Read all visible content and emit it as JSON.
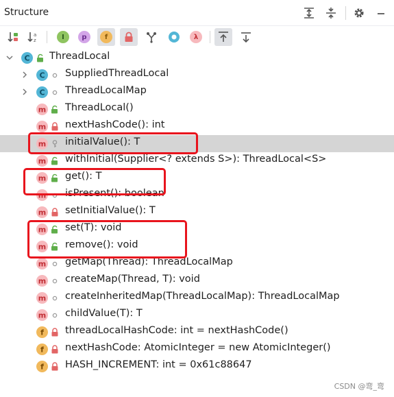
{
  "panel": {
    "title": "Structure"
  },
  "title_actions": [
    "expand-all-icon",
    "collapse-all-icon",
    "gear-icon",
    "minimize-icon"
  ],
  "toolbar": {
    "items": [
      {
        "name": "sort-visibility-icon",
        "active": false
      },
      {
        "name": "sort-alphabetically-icon",
        "active": false
      },
      {
        "name": "show-inherited-icon",
        "active": false,
        "glyph": "I"
      },
      {
        "name": "show-properties-icon",
        "active": false,
        "glyph": "p"
      },
      {
        "name": "show-fields-icon",
        "active": true,
        "glyph": "f"
      },
      {
        "name": "show-non-public-icon",
        "active": true
      },
      {
        "name": "show-lambdas-tree-icon",
        "active": false
      },
      {
        "name": "show-anonymous-icon",
        "active": false
      },
      {
        "name": "show-lambdas-icon",
        "active": false,
        "glyph": "λ"
      },
      {
        "name": "autoscroll-to-source-icon",
        "active": true
      },
      {
        "name": "autoscroll-from-source-icon",
        "active": false
      }
    ]
  },
  "colors": {
    "class_badge": "#53b6d6",
    "method_badge": "#f7b9bd",
    "method_text": "#c12e34",
    "field_badge": "#f1b95c",
    "selection": "#d5d5d5",
    "highlight_border": "#e8141d",
    "public_lock": "#5fae4a",
    "private_lock": "#e26565"
  },
  "tree": {
    "root": {
      "label": "ThreadLocal",
      "kind": "class",
      "visibility": "public",
      "expanded": true
    },
    "items": [
      {
        "label": "SuppliedThreadLocal",
        "kind": "class",
        "visibility": "package",
        "expandable": true
      },
      {
        "label": "ThreadLocalMap",
        "kind": "class",
        "visibility": "package",
        "expandable": true
      },
      {
        "label": "ThreadLocal()",
        "kind": "method",
        "visibility": "public"
      },
      {
        "label": "nextHashCode(): int",
        "kind": "method",
        "visibility": "private"
      },
      {
        "label": "initialValue(): T",
        "kind": "method",
        "visibility": "protected",
        "selected": true
      },
      {
        "label": "withInitial(Supplier<? extends S>): ThreadLocal<S>",
        "kind": "method",
        "visibility": "public"
      },
      {
        "label": "get(): T",
        "kind": "method",
        "visibility": "public"
      },
      {
        "label": "isPresent(): boolean",
        "kind": "method",
        "visibility": "package"
      },
      {
        "label": "setInitialValue(): T",
        "kind": "method",
        "visibility": "private"
      },
      {
        "label": "set(T): void",
        "kind": "method",
        "visibility": "public"
      },
      {
        "label": "remove(): void",
        "kind": "method",
        "visibility": "public"
      },
      {
        "label": "getMap(Thread): ThreadLocalMap",
        "kind": "method",
        "visibility": "package"
      },
      {
        "label": "createMap(Thread, T): void",
        "kind": "method",
        "visibility": "package"
      },
      {
        "label": "createInheritedMap(ThreadLocalMap): ThreadLocalMap",
        "kind": "method",
        "visibility": "package"
      },
      {
        "label": "childValue(T): T",
        "kind": "method",
        "visibility": "package"
      },
      {
        "label": "threadLocalHashCode: int = nextHashCode()",
        "kind": "field",
        "visibility": "private"
      },
      {
        "label": "nextHashCode: AtomicInteger = new AtomicInteger()",
        "kind": "field",
        "visibility": "private"
      },
      {
        "label": "HASH_INCREMENT: int = 0x61c88647",
        "kind": "field",
        "visibility": "private"
      }
    ]
  },
  "watermark": "CSDN @弯_弯"
}
